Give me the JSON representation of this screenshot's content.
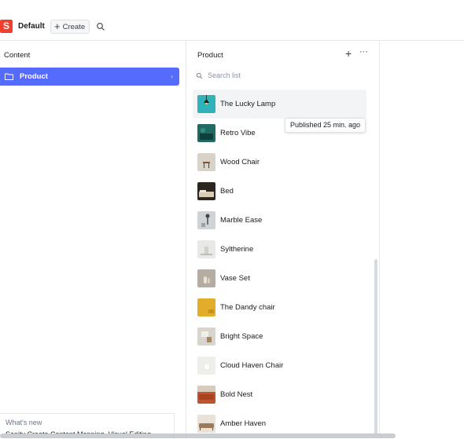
{
  "topbar": {
    "logo_letter": "S",
    "workspace_name": "Default",
    "create_label": "Create"
  },
  "content_pane": {
    "title": "Content",
    "items": [
      {
        "label": "Product"
      }
    ]
  },
  "whats_new": {
    "heading": "What's new",
    "text": "Sanity Create Content Mapping, Visual Editing"
  },
  "product_pane": {
    "title": "Product",
    "search_placeholder": "Search list",
    "tooltip": "Published 25 min. ago",
    "documents": [
      {
        "title": "The Lucky Lamp",
        "thumb_color": "#2fb3b8"
      },
      {
        "title": "Retro Vibe",
        "thumb_color": "#1f6b63"
      },
      {
        "title": "Wood Chair",
        "thumb_color": "#d8d2c8"
      },
      {
        "title": "Bed",
        "thumb_color": "#2b2620"
      },
      {
        "title": "Marble Ease",
        "thumb_color": "#cfd3d6"
      },
      {
        "title": "Syltherine",
        "thumb_color": "#e8e8e6"
      },
      {
        "title": "Vase Set",
        "thumb_color": "#b5aca2"
      },
      {
        "title": "The Dandy chair",
        "thumb_color": "#e2ad2a"
      },
      {
        "title": "Bright Space",
        "thumb_color": "#d9d4cc"
      },
      {
        "title": "Cloud Haven Chair",
        "thumb_color": "#eeeeea"
      },
      {
        "title": "Bold Nest",
        "thumb_color": "#c0542f"
      },
      {
        "title": "Amber Haven",
        "thumb_color": "#9c7a5a"
      }
    ]
  },
  "colors": {
    "accent": "#556bfc",
    "brand": "#f03e2f"
  }
}
